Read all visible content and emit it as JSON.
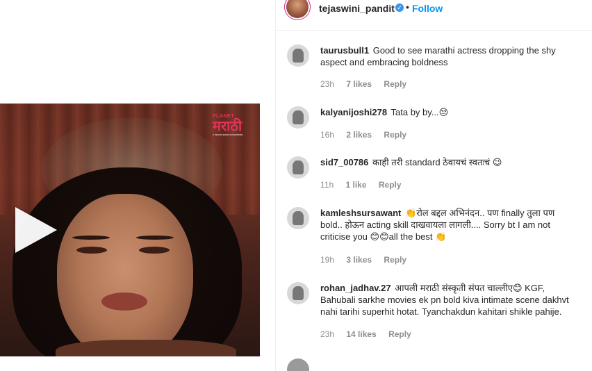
{
  "post": {
    "username": "tejaswini_pandit",
    "verified_icon": "verified-badge-icon",
    "separator": "•",
    "follow_label": "Follow",
    "follow_color": "#0095f6"
  },
  "media": {
    "brand_top": "PLANET",
    "brand_main": "मराठी",
    "brand_tag": "A PRAVIN MANE ENTERPRISE",
    "brand_color": "#e4325a",
    "play_icon": "play-icon"
  },
  "comments": [
    {
      "username": "taurusbull1",
      "text": "Good to see marathi actress dropping the shy aspect and embracing boldness",
      "time": "23h",
      "likes": "7 likes",
      "reply": "Reply"
    },
    {
      "username": "kalyanijoshi278",
      "text": "Tata by by...😒",
      "time": "16h",
      "likes": "2 likes",
      "reply": "Reply"
    },
    {
      "username": "sid7_00786",
      "text": "काही तरी standard ठेवायचं स्वतःचं 😉",
      "time": "11h",
      "likes": "1 like",
      "reply": "Reply"
    },
    {
      "username": "kamleshsursawant",
      "text": "👏रोल बद्दल अभिनंदन.. पण finally तुला पण bold.. होऊन acting skill दाखवायला लागली.... Sorry bt I am not criticise you 😊😊all the best 👏",
      "time": "19h",
      "likes": "3 likes",
      "reply": "Reply"
    },
    {
      "username": "rohan_jadhav.27",
      "text": "आपली मराठी संस्कृती संपत चाल्लीए😊 KGF, Bahubali sarkhe movies ek pn bold kiva intimate scene dakhvt nahi tarihi superhit hotat. Tyanchakdun kahitari shikle pahije.",
      "time": "23h",
      "likes": "14 likes",
      "reply": "Reply"
    }
  ]
}
